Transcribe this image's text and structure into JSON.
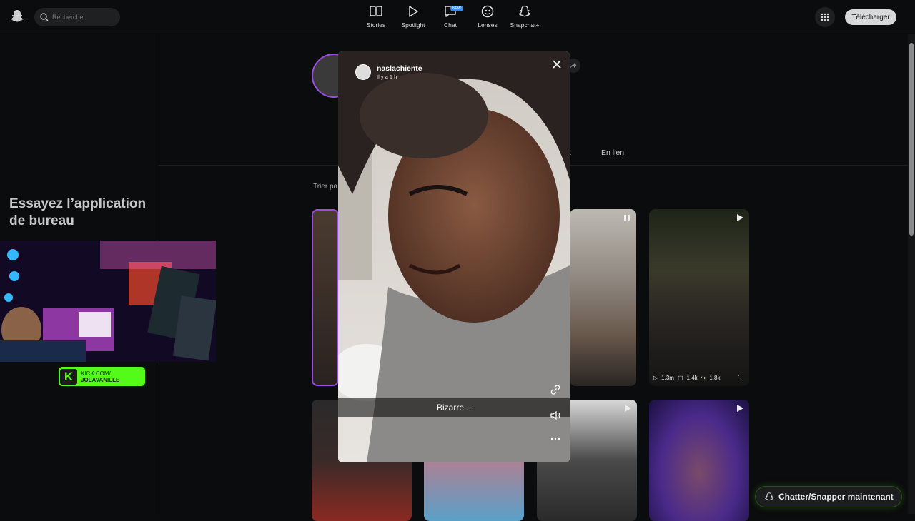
{
  "header": {
    "search_placeholder": "Rechercher",
    "nav": [
      {
        "label": "Stories",
        "icon": "stories-icon"
      },
      {
        "label": "Spotlight",
        "icon": "spotlight-icon"
      },
      {
        "label": "Chat",
        "icon": "chat-icon",
        "badge": "NEW"
      },
      {
        "label": "Lenses",
        "icon": "lenses-icon"
      },
      {
        "label": "Snapchat+",
        "icon": "snapchat-plus-icon"
      }
    ],
    "download_label": "Télécharger"
  },
  "sidebar": {
    "promo_title": "Essayez l’application de bureau"
  },
  "profile": {
    "tab_partial": "nt",
    "tab_linked": "En lien",
    "sort_label": "Trier pa"
  },
  "stream_overlay": {
    "kick_line1": "KICK.COM/",
    "kick_line2": "JOLAVANILLE"
  },
  "viewer": {
    "username": "naslachiente",
    "time_ago": "Il y a 1 h",
    "caption": "Bizarre..."
  },
  "grid": [
    {
      "views": "1.3m",
      "comments": "1.4k",
      "shares": "1.8k"
    }
  ],
  "chat_cta": "Chatter/Snapper maintenant",
  "colors": {
    "accent_purple": "#9b4de0",
    "kick_green": "#53fc18",
    "background": "#0b0c0d"
  }
}
